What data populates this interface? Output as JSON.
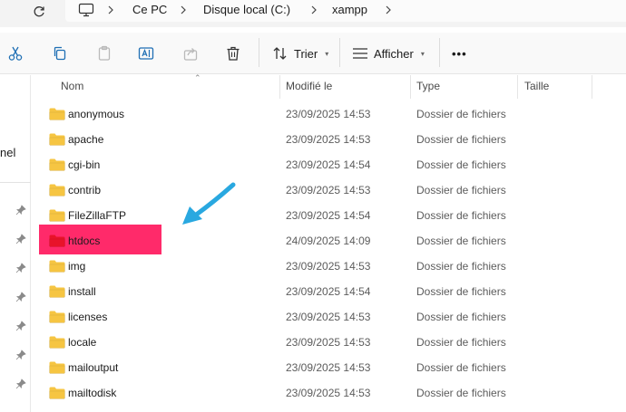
{
  "address": {
    "crumbs": [
      {
        "label": "Ce PC"
      },
      {
        "label": "Disque local (C:)"
      },
      {
        "label": "xampp"
      }
    ]
  },
  "toolbar": {
    "icons": [
      "cut-icon",
      "copy-icon",
      "paste-icon",
      "rename-icon",
      "share-icon",
      "delete-icon"
    ],
    "sort_label": "Trier",
    "view_label": "Afficher",
    "more_label": "•••"
  },
  "nav": {
    "partial_label": "nel"
  },
  "columns": {
    "name": "Nom",
    "modified": "Modifié le",
    "type": "Type",
    "size": "Taille"
  },
  "files": [
    {
      "name": "anonymous",
      "modified": "23/09/2025 14:53",
      "type": "Dossier de fichiers"
    },
    {
      "name": "apache",
      "modified": "23/09/2025 14:53",
      "type": "Dossier de fichiers"
    },
    {
      "name": "cgi-bin",
      "modified": "23/09/2025 14:54",
      "type": "Dossier de fichiers"
    },
    {
      "name": "contrib",
      "modified": "23/09/2025 14:53",
      "type": "Dossier de fichiers"
    },
    {
      "name": "FileZillaFTP",
      "modified": "23/09/2025 14:54",
      "type": "Dossier de fichiers"
    },
    {
      "name": "htdocs",
      "modified": "24/09/2025 14:09",
      "type": "Dossier de fichiers",
      "highlighted": true
    },
    {
      "name": "img",
      "modified": "23/09/2025 14:53",
      "type": "Dossier de fichiers"
    },
    {
      "name": "install",
      "modified": "23/09/2025 14:54",
      "type": "Dossier de fichiers"
    },
    {
      "name": "licenses",
      "modified": "23/09/2025 14:53",
      "type": "Dossier de fichiers"
    },
    {
      "name": "locale",
      "modified": "23/09/2025 14:53",
      "type": "Dossier de fichiers"
    },
    {
      "name": "mailoutput",
      "modified": "23/09/2025 14:53",
      "type": "Dossier de fichiers"
    },
    {
      "name": "mailtodisk",
      "modified": "23/09/2025 14:53",
      "type": "Dossier de fichiers"
    }
  ],
  "colors": {
    "highlight": "#ff2a6a",
    "arrow": "#29a8e0",
    "folder": "#f6c542",
    "folder_highlighted": "#e8132a"
  }
}
